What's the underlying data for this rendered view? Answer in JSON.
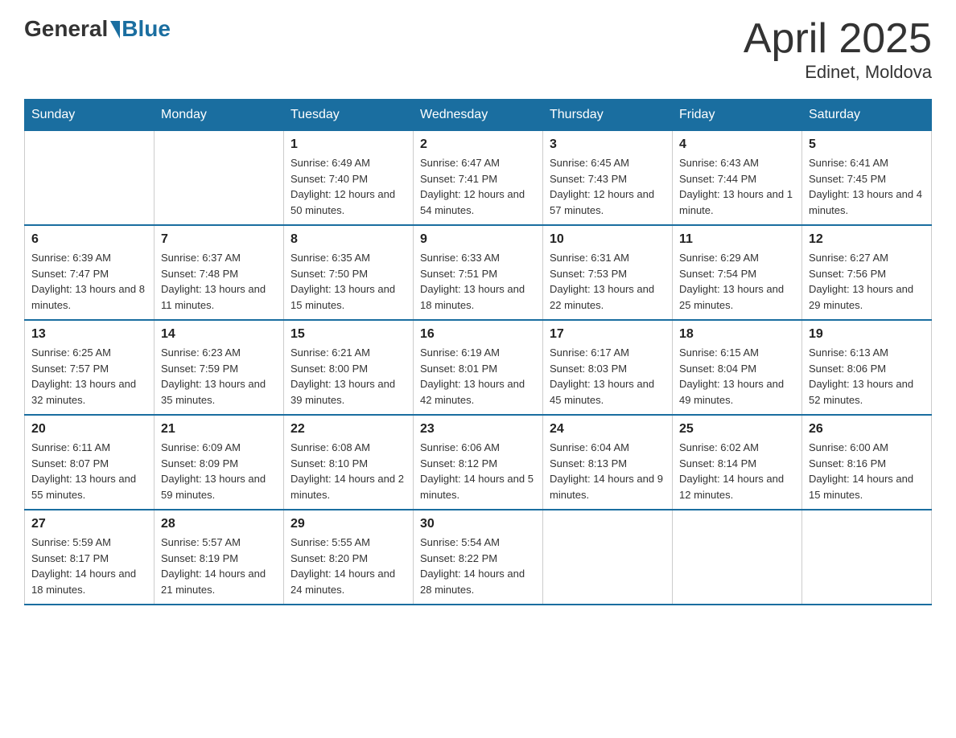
{
  "logo": {
    "general": "General",
    "blue": "Blue"
  },
  "title": "April 2025",
  "subtitle": "Edinet, Moldova",
  "weekdays": [
    "Sunday",
    "Monday",
    "Tuesday",
    "Wednesday",
    "Thursday",
    "Friday",
    "Saturday"
  ],
  "weeks": [
    [
      null,
      null,
      {
        "day": 1,
        "sunrise": "6:49 AM",
        "sunset": "7:40 PM",
        "daylight": "12 hours and 50 minutes."
      },
      {
        "day": 2,
        "sunrise": "6:47 AM",
        "sunset": "7:41 PM",
        "daylight": "12 hours and 54 minutes."
      },
      {
        "day": 3,
        "sunrise": "6:45 AM",
        "sunset": "7:43 PM",
        "daylight": "12 hours and 57 minutes."
      },
      {
        "day": 4,
        "sunrise": "6:43 AM",
        "sunset": "7:44 PM",
        "daylight": "13 hours and 1 minute."
      },
      {
        "day": 5,
        "sunrise": "6:41 AM",
        "sunset": "7:45 PM",
        "daylight": "13 hours and 4 minutes."
      }
    ],
    [
      {
        "day": 6,
        "sunrise": "6:39 AM",
        "sunset": "7:47 PM",
        "daylight": "13 hours and 8 minutes."
      },
      {
        "day": 7,
        "sunrise": "6:37 AM",
        "sunset": "7:48 PM",
        "daylight": "13 hours and 11 minutes."
      },
      {
        "day": 8,
        "sunrise": "6:35 AM",
        "sunset": "7:50 PM",
        "daylight": "13 hours and 15 minutes."
      },
      {
        "day": 9,
        "sunrise": "6:33 AM",
        "sunset": "7:51 PM",
        "daylight": "13 hours and 18 minutes."
      },
      {
        "day": 10,
        "sunrise": "6:31 AM",
        "sunset": "7:53 PM",
        "daylight": "13 hours and 22 minutes."
      },
      {
        "day": 11,
        "sunrise": "6:29 AM",
        "sunset": "7:54 PM",
        "daylight": "13 hours and 25 minutes."
      },
      {
        "day": 12,
        "sunrise": "6:27 AM",
        "sunset": "7:56 PM",
        "daylight": "13 hours and 29 minutes."
      }
    ],
    [
      {
        "day": 13,
        "sunrise": "6:25 AM",
        "sunset": "7:57 PM",
        "daylight": "13 hours and 32 minutes."
      },
      {
        "day": 14,
        "sunrise": "6:23 AM",
        "sunset": "7:59 PM",
        "daylight": "13 hours and 35 minutes."
      },
      {
        "day": 15,
        "sunrise": "6:21 AM",
        "sunset": "8:00 PM",
        "daylight": "13 hours and 39 minutes."
      },
      {
        "day": 16,
        "sunrise": "6:19 AM",
        "sunset": "8:01 PM",
        "daylight": "13 hours and 42 minutes."
      },
      {
        "day": 17,
        "sunrise": "6:17 AM",
        "sunset": "8:03 PM",
        "daylight": "13 hours and 45 minutes."
      },
      {
        "day": 18,
        "sunrise": "6:15 AM",
        "sunset": "8:04 PM",
        "daylight": "13 hours and 49 minutes."
      },
      {
        "day": 19,
        "sunrise": "6:13 AM",
        "sunset": "8:06 PM",
        "daylight": "13 hours and 52 minutes."
      }
    ],
    [
      {
        "day": 20,
        "sunrise": "6:11 AM",
        "sunset": "8:07 PM",
        "daylight": "13 hours and 55 minutes."
      },
      {
        "day": 21,
        "sunrise": "6:09 AM",
        "sunset": "8:09 PM",
        "daylight": "13 hours and 59 minutes."
      },
      {
        "day": 22,
        "sunrise": "6:08 AM",
        "sunset": "8:10 PM",
        "daylight": "14 hours and 2 minutes."
      },
      {
        "day": 23,
        "sunrise": "6:06 AM",
        "sunset": "8:12 PM",
        "daylight": "14 hours and 5 minutes."
      },
      {
        "day": 24,
        "sunrise": "6:04 AM",
        "sunset": "8:13 PM",
        "daylight": "14 hours and 9 minutes."
      },
      {
        "day": 25,
        "sunrise": "6:02 AM",
        "sunset": "8:14 PM",
        "daylight": "14 hours and 12 minutes."
      },
      {
        "day": 26,
        "sunrise": "6:00 AM",
        "sunset": "8:16 PM",
        "daylight": "14 hours and 15 minutes."
      }
    ],
    [
      {
        "day": 27,
        "sunrise": "5:59 AM",
        "sunset": "8:17 PM",
        "daylight": "14 hours and 18 minutes."
      },
      {
        "day": 28,
        "sunrise": "5:57 AM",
        "sunset": "8:19 PM",
        "daylight": "14 hours and 21 minutes."
      },
      {
        "day": 29,
        "sunrise": "5:55 AM",
        "sunset": "8:20 PM",
        "daylight": "14 hours and 24 minutes."
      },
      {
        "day": 30,
        "sunrise": "5:54 AM",
        "sunset": "8:22 PM",
        "daylight": "14 hours and 28 minutes."
      },
      null,
      null,
      null
    ]
  ]
}
